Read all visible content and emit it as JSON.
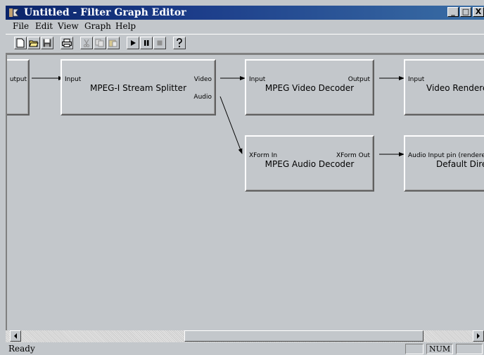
{
  "window": {
    "title": "Untitled - Filter Graph Editor",
    "controls": {
      "minimize": "_",
      "maximize": "□",
      "close": "X"
    }
  },
  "menu": {
    "items": [
      {
        "label": "File",
        "hotkey": "F"
      },
      {
        "label": "Edit",
        "hotkey": "E"
      },
      {
        "label": "View",
        "hotkey": "V"
      },
      {
        "label": "Graph",
        "hotkey": "G"
      },
      {
        "label": "Help",
        "hotkey": "H"
      }
    ]
  },
  "toolbar": {
    "buttons": [
      "new-icon",
      "open-icon",
      "save-icon",
      "print-icon",
      "cut-icon",
      "copy-icon",
      "paste-icon",
      "play-icon",
      "pause-icon",
      "stop-icon",
      "help-icon"
    ]
  },
  "graph": {
    "filters": {
      "source": {
        "name": "",
        "pins": {
          "out": "utput"
        }
      },
      "splitter": {
        "name": "MPEG-I Stream Splitter",
        "pins": {
          "in": "Input",
          "video": "Video",
          "audio": "Audio"
        }
      },
      "video_decoder": {
        "name": "MPEG Video Decoder",
        "pins": {
          "in": "Input",
          "out": "Output"
        }
      },
      "video_renderer": {
        "name": "Video Renderer",
        "pins": {
          "in": "Input"
        }
      },
      "audio_decoder": {
        "name": "MPEG Audio Decoder",
        "pins": {
          "in": "XForm In",
          "out": "XForm Out"
        }
      },
      "audio_renderer": {
        "name": "Default Direct",
        "pins": {
          "in": "Audio Input pin (rendered)"
        }
      }
    }
  },
  "statusbar": {
    "text": "Ready",
    "num": "NUM"
  },
  "colors": {
    "face": "#c3c7cb",
    "title_start": "#0a246a",
    "title_end": "#3a6ea5"
  }
}
